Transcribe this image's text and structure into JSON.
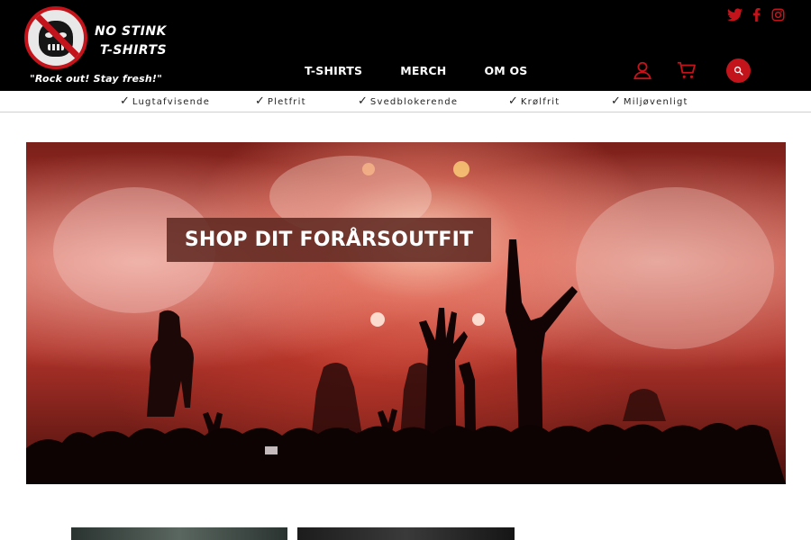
{
  "brand": {
    "name_line1": "NO STINK",
    "name_line2": "T-SHIRTS",
    "tagline": "\"Rock out! Stay fresh!\"",
    "accent_color": "#c4141b"
  },
  "socials": [
    "twitter-icon",
    "facebook-icon",
    "instagram-icon"
  ],
  "nav": {
    "items": [
      {
        "label": "T-SHIRTS"
      },
      {
        "label": "MERCH"
      },
      {
        "label": "OM OS"
      }
    ]
  },
  "header_icons": [
    "user-icon",
    "cart-icon",
    "search-icon"
  ],
  "usp": {
    "items": [
      {
        "label": "Lugtafvisende"
      },
      {
        "label": "Pletfrit"
      },
      {
        "label": "Svedblokerende"
      },
      {
        "label": "Krølfrit"
      },
      {
        "label": "Miljøvenligt"
      }
    ],
    "check": "✓"
  },
  "hero": {
    "headline": "SHOP DIT FORÅRSOUTFIT"
  }
}
